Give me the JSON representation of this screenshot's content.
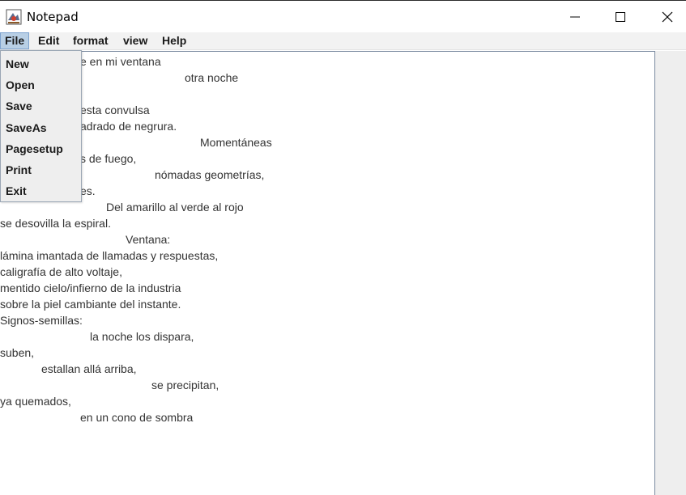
{
  "window": {
    "title": "Notepad",
    "icon": "java-app-icon",
    "controls": {
      "minimize": "minimize-icon",
      "maximize": "maximize-icon",
      "close": "close-icon"
    }
  },
  "menubar": {
    "items": [
      "File",
      "Edit",
      "format",
      "view",
      "Help"
    ]
  },
  "file_menu": {
    "items": [
      "New",
      "Open",
      "Save",
      "SaveAs",
      "Pagesetup",
      "Print",
      "Exit"
    ]
  },
  "editor": {
    "lines": [
      "e en mi ventana",
      "otra noche",
      "esta convulsa",
      "adrado de negrura.",
      "Momentáneas",
      "s de fuego,",
      "nómadas geometrías,",
      "es.",
      "Del amarillo al verde al rojo",
      "se desovilla la espiral.",
      "Ventana:",
      "lámina imantada de llamadas y respuestas,",
      "caligrafía de alto voltaje,",
      "mentido cielo/infierno de la industria",
      "sobre la piel cambiante del instante.",
      "Signos-semillas:",
      "la noche los dispara,",
      "suben,",
      "estallan allá arriba,",
      "se precipitan,",
      "ya quemados,",
      "en un cono de sombra"
    ]
  },
  "colors": {
    "menu_active_bg": "#b8cfe5",
    "menu_active_border": "#7da2ce",
    "dropdown_bg": "#eeeeee",
    "text": "#333333"
  }
}
